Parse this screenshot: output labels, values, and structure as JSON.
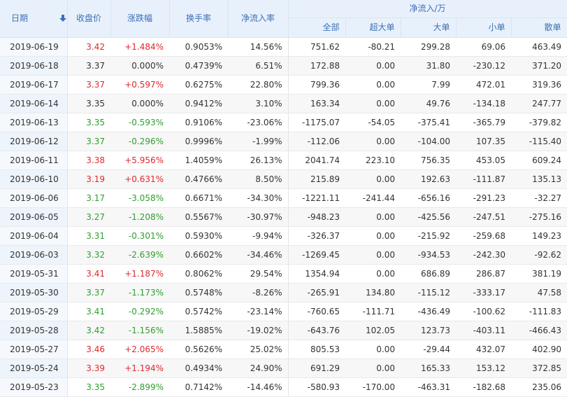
{
  "headers": {
    "date": "日期",
    "close": "收盘价",
    "change_pct": "涨跌幅",
    "turnover": "换手率",
    "net_inflow_rate": "净流入率",
    "net_inflow_group": "净流入/万",
    "total": "全部",
    "super_large": "超大单",
    "large": "大单",
    "small": "小单",
    "retail": "散单"
  },
  "icons": {
    "sort": "sort-down-arrow-icon"
  },
  "colors": {
    "up": "#e0282e",
    "down": "#2e9f2e",
    "header_bg": "#e8f1fb",
    "header_text": "#3b6fb6"
  },
  "rows": [
    {
      "date": "2019-06-19",
      "close": "3.42",
      "change": "+1.484%",
      "turnover": "0.9053%",
      "net_rate": "14.56%",
      "total": "751.62",
      "super": "-80.21",
      "large": "299.28",
      "small": "69.06",
      "retail": "463.49",
      "trend": "up"
    },
    {
      "date": "2019-06-18",
      "close": "3.37",
      "change": "0.000%",
      "turnover": "0.4739%",
      "net_rate": "6.51%",
      "total": "172.88",
      "super": "0.00",
      "large": "31.80",
      "small": "-230.12",
      "retail": "371.20",
      "trend": "flat"
    },
    {
      "date": "2019-06-17",
      "close": "3.37",
      "change": "+0.597%",
      "turnover": "0.6275%",
      "net_rate": "22.80%",
      "total": "799.36",
      "super": "0.00",
      "large": "7.99",
      "small": "472.01",
      "retail": "319.36",
      "trend": "up"
    },
    {
      "date": "2019-06-14",
      "close": "3.35",
      "change": "0.000%",
      "turnover": "0.9412%",
      "net_rate": "3.10%",
      "total": "163.34",
      "super": "0.00",
      "large": "49.76",
      "small": "-134.18",
      "retail": "247.77",
      "trend": "flat"
    },
    {
      "date": "2019-06-13",
      "close": "3.35",
      "change": "-0.593%",
      "turnover": "0.9106%",
      "net_rate": "-23.06%",
      "total": "-1175.07",
      "super": "-54.05",
      "large": "-375.41",
      "small": "-365.79",
      "retail": "-379.82",
      "trend": "down"
    },
    {
      "date": "2019-06-12",
      "close": "3.37",
      "change": "-0.296%",
      "turnover": "0.9996%",
      "net_rate": "-1.99%",
      "total": "-112.06",
      "super": "0.00",
      "large": "-104.00",
      "small": "107.35",
      "retail": "-115.40",
      "trend": "down"
    },
    {
      "date": "2019-06-11",
      "close": "3.38",
      "change": "+5.956%",
      "turnover": "1.4059%",
      "net_rate": "26.13%",
      "total": "2041.74",
      "super": "223.10",
      "large": "756.35",
      "small": "453.05",
      "retail": "609.24",
      "trend": "up"
    },
    {
      "date": "2019-06-10",
      "close": "3.19",
      "change": "+0.631%",
      "turnover": "0.4766%",
      "net_rate": "8.50%",
      "total": "215.89",
      "super": "0.00",
      "large": "192.63",
      "small": "-111.87",
      "retail": "135.13",
      "trend": "up"
    },
    {
      "date": "2019-06-06",
      "close": "3.17",
      "change": "-3.058%",
      "turnover": "0.6671%",
      "net_rate": "-34.30%",
      "total": "-1221.11",
      "super": "-241.44",
      "large": "-656.16",
      "small": "-291.23",
      "retail": "-32.27",
      "trend": "down"
    },
    {
      "date": "2019-06-05",
      "close": "3.27",
      "change": "-1.208%",
      "turnover": "0.5567%",
      "net_rate": "-30.97%",
      "total": "-948.23",
      "super": "0.00",
      "large": "-425.56",
      "small": "-247.51",
      "retail": "-275.16",
      "trend": "down"
    },
    {
      "date": "2019-06-04",
      "close": "3.31",
      "change": "-0.301%",
      "turnover": "0.5930%",
      "net_rate": "-9.94%",
      "total": "-326.37",
      "super": "0.00",
      "large": "-215.92",
      "small": "-259.68",
      "retail": "149.23",
      "trend": "down"
    },
    {
      "date": "2019-06-03",
      "close": "3.32",
      "change": "-2.639%",
      "turnover": "0.6602%",
      "net_rate": "-34.46%",
      "total": "-1269.45",
      "super": "0.00",
      "large": "-934.53",
      "small": "-242.30",
      "retail": "-92.62",
      "trend": "down"
    },
    {
      "date": "2019-05-31",
      "close": "3.41",
      "change": "+1.187%",
      "turnover": "0.8062%",
      "net_rate": "29.54%",
      "total": "1354.94",
      "super": "0.00",
      "large": "686.89",
      "small": "286.87",
      "retail": "381.19",
      "trend": "up"
    },
    {
      "date": "2019-05-30",
      "close": "3.37",
      "change": "-1.173%",
      "turnover": "0.5748%",
      "net_rate": "-8.26%",
      "total": "-265.91",
      "super": "134.80",
      "large": "-115.12",
      "small": "-333.17",
      "retail": "47.58",
      "trend": "down"
    },
    {
      "date": "2019-05-29",
      "close": "3.41",
      "change": "-0.292%",
      "turnover": "0.5742%",
      "net_rate": "-23.14%",
      "total": "-760.65",
      "super": "-111.71",
      "large": "-436.49",
      "small": "-100.62",
      "retail": "-111.83",
      "trend": "down"
    },
    {
      "date": "2019-05-28",
      "close": "3.42",
      "change": "-1.156%",
      "turnover": "1.5885%",
      "net_rate": "-19.02%",
      "total": "-643.76",
      "super": "102.05",
      "large": "123.73",
      "small": "-403.11",
      "retail": "-466.43",
      "trend": "down"
    },
    {
      "date": "2019-05-27",
      "close": "3.46",
      "change": "+2.065%",
      "turnover": "0.5626%",
      "net_rate": "25.02%",
      "total": "805.53",
      "super": "0.00",
      "large": "-29.44",
      "small": "432.07",
      "retail": "402.90",
      "trend": "up"
    },
    {
      "date": "2019-05-24",
      "close": "3.39",
      "change": "+1.194%",
      "turnover": "0.4934%",
      "net_rate": "24.90%",
      "total": "691.29",
      "super": "0.00",
      "large": "165.33",
      "small": "153.12",
      "retail": "372.85",
      "trend": "up"
    },
    {
      "date": "2019-05-23",
      "close": "3.35",
      "change": "-2.899%",
      "turnover": "0.7142%",
      "net_rate": "-14.46%",
      "total": "-580.93",
      "super": "-170.00",
      "large": "-463.31",
      "small": "-182.68",
      "retail": "235.06",
      "trend": "down"
    }
  ]
}
